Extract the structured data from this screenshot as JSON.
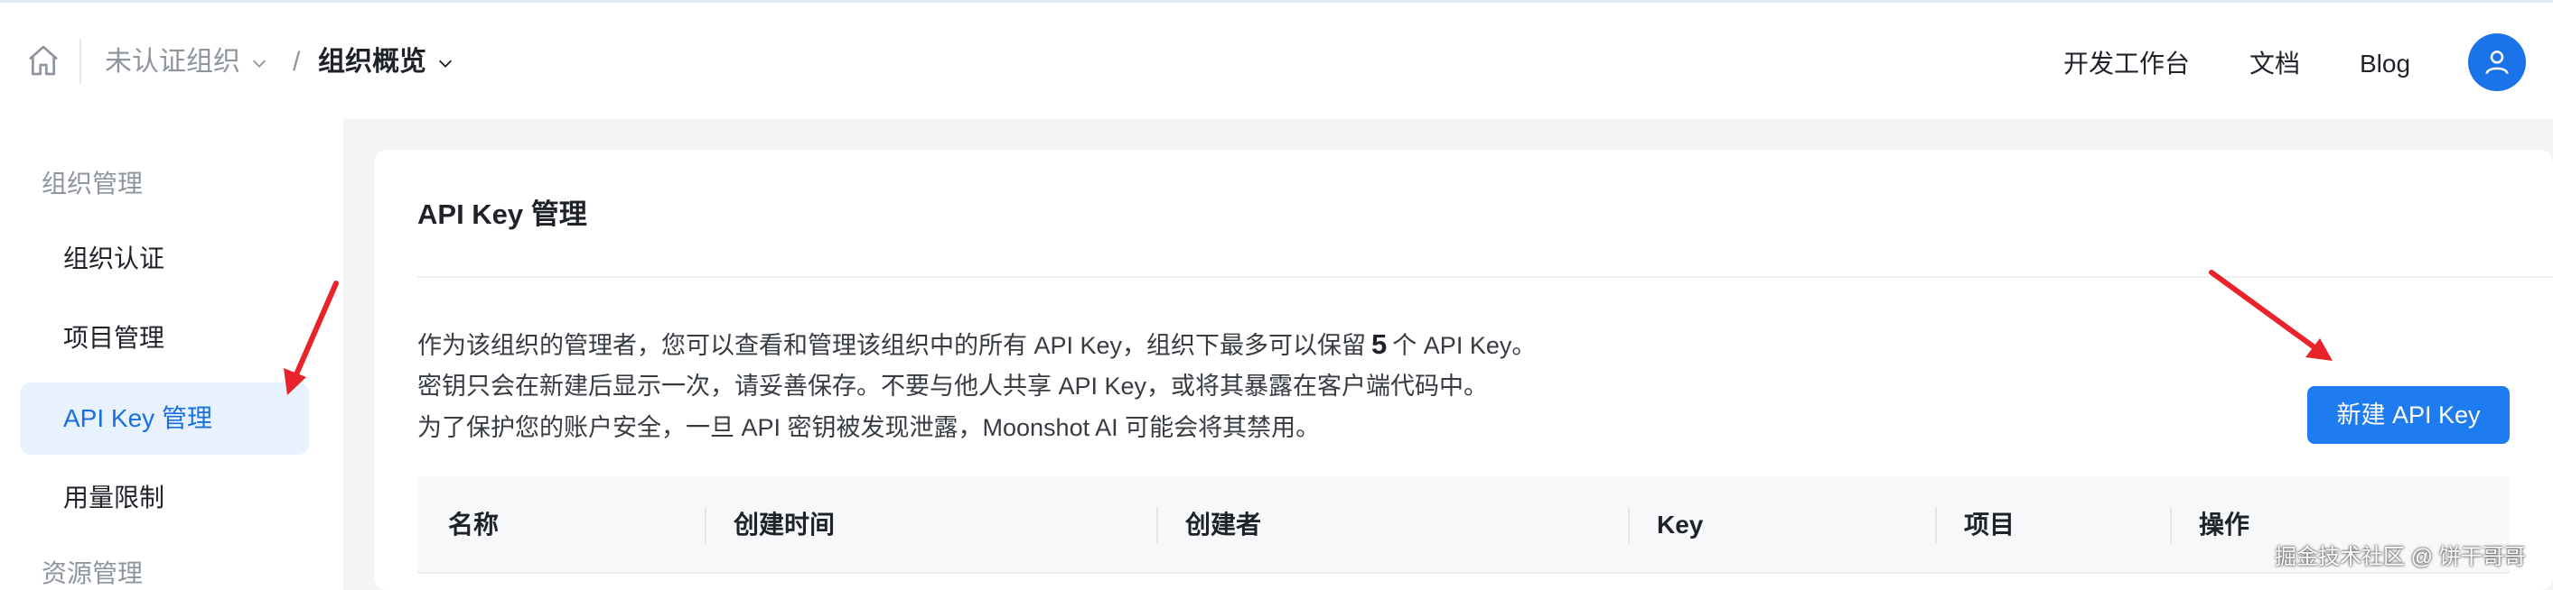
{
  "header": {
    "breadcrumb_org": "未认证组织",
    "breadcrumb_sep": "/",
    "breadcrumb_page": "组织概览",
    "nav": {
      "dev": "开发工作台",
      "docs": "文档",
      "blog": "Blog"
    }
  },
  "sidebar": {
    "group_org": "组织管理",
    "items": [
      {
        "label": "组织认证"
      },
      {
        "label": "项目管理"
      },
      {
        "label": "API Key 管理"
      },
      {
        "label": "用量限制"
      }
    ],
    "group_res": "资源管理"
  },
  "main": {
    "title": "API Key 管理",
    "desc_line1_a": "作为该组织的管理者，您可以查看和管理该组织中的所有 API Key，组织下最多可以保留",
    "desc_line1_count": "5",
    "desc_line1_b": "个 API Key。",
    "desc_line2": "密钥只会在新建后显示一次，请妥善保存。不要与他人共享 API Key，或将其暴露在客户端代码中。",
    "desc_line3": "为了保护您的账户安全，一旦 API 密钥被发现泄露，Moonshot AI 可能会将其禁用。",
    "new_button": "新建 API Key",
    "table_headers": [
      "名称",
      "创建时间",
      "创建者",
      "Key",
      "项目",
      "操作"
    ]
  },
  "watermark": "掘金技术社区 @ 饼干哥哥",
  "colors": {
    "accent": "#1f7bf0",
    "active_bg": "#e8f2fe",
    "arrow": "#e8232a"
  }
}
